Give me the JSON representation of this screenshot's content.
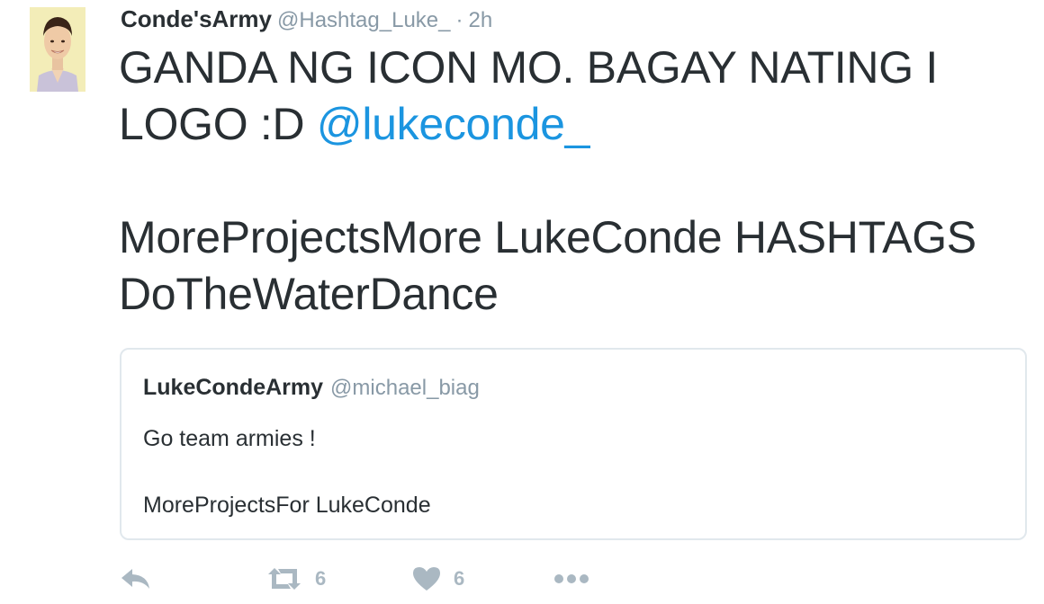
{
  "tweet": {
    "author_name": "Conde'sArmy",
    "author_handle": "@Hashtag_Luke_",
    "separator": "·",
    "time": "2h",
    "text_line1": "GANDA NG ICON MO. BAGAY NATING I LOGO :D ",
    "mention": "@lukeconde_",
    "text_para2": "MoreProjectsMore LukeConde HASHTAGS DoTheWaterDance"
  },
  "quoted": {
    "author_name": "LukeCondeArmy",
    "author_handle": "@michael_biag",
    "line1": "Go team armies !",
    "line2": "MoreProjectsFor LukeConde"
  },
  "actions": {
    "reply_icon": "reply-icon",
    "retweet_icon": "retweet-icon",
    "retweet_count": "6",
    "like_icon": "heart-icon",
    "like_count": "6",
    "more_icon": "more-icon"
  },
  "colors": {
    "link": "#1b95e0",
    "muted": "#8899a6",
    "icon": "#aab8c2",
    "text": "#292f33",
    "border": "#e1e8ed"
  }
}
